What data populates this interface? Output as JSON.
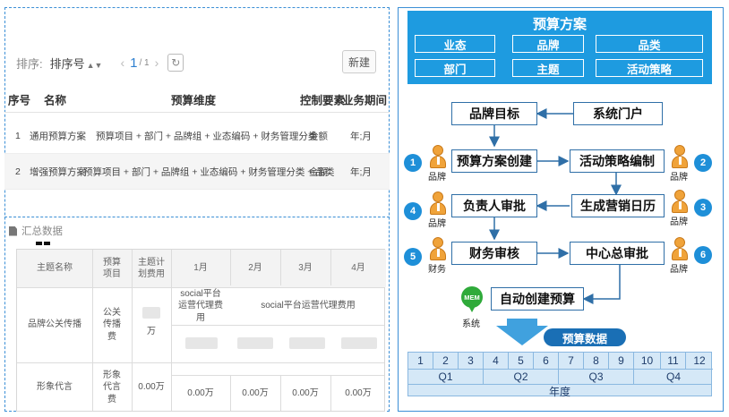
{
  "plan_list": {
    "sort_label": "排序:",
    "sort_value": "排序号",
    "sort_arrows": "▲▼",
    "prev_icon": "‹",
    "next_icon": "›",
    "page_current": "1",
    "page_total": "/ 1",
    "refresh_icon": "↻",
    "new_button": "新建",
    "columns": [
      "序号",
      "名称",
      "预算维度",
      "控制要素",
      "业务期间"
    ],
    "rows": [
      [
        "1",
        "通用预算方案",
        "预算项目 + 部门 + 品牌组 + 业态编码 + 财务管理分类",
        "金额",
        "年;月"
      ],
      [
        "2",
        "增强预算方案",
        "预算项目 + 部门 + 品牌组 + 业态编码 + 财务管理分类 + 品类",
        "金额",
        "年;月"
      ]
    ]
  },
  "summary": {
    "title": "汇总数据",
    "columns": [
      "主题名称",
      "预算项目",
      "主题计划费用",
      "1月",
      "2月",
      "3月",
      "4月"
    ],
    "rows": [
      {
        "name": "品牌公关传播",
        "item": "公关传播费",
        "unit": "万",
        "subheader_1": "social平台运营代理费用",
        "subheader_2": "social平台运营代理费用"
      },
      {
        "name": "形象代言",
        "item": "形象代言费",
        "plan": "0.00万",
        "months": [
          "0.00万",
          "0.00万",
          "0.00万",
          "0.00万"
        ]
      }
    ]
  },
  "flow": {
    "banner_title": "预算方案",
    "dimensions": [
      "业态",
      "品牌",
      "品类",
      "部门",
      "主题",
      "活动策略"
    ],
    "boxes": {
      "brand_target": "品牌目标",
      "system_portal": "系统门户",
      "create_plan": "预算方案创建",
      "strategy": "活动策略编制",
      "owner_approval": "负责人审批",
      "calendar": "生成营销日历",
      "finance_review": "财务审核",
      "center_approval": "中心总审批",
      "auto_budget": "自动创建预算"
    },
    "steps": [
      "1",
      "2",
      "3",
      "4",
      "5",
      "6"
    ],
    "roles": {
      "step1": "品牌",
      "step2": "品牌",
      "step3": "品牌",
      "step4": "品牌",
      "step5": "财务",
      "step6": "品牌",
      "system": "系统"
    },
    "mem_label": "MEM",
    "data_label": "预算数据",
    "months": [
      "1",
      "2",
      "3",
      "4",
      "5",
      "6",
      "7",
      "8",
      "9",
      "10",
      "11",
      "12"
    ],
    "quarters": [
      "Q1",
      "Q2",
      "Q3",
      "Q4"
    ],
    "year_label": "年度"
  },
  "colors": {
    "banner": "#1e9be0",
    "box_border": "#2f6fa7",
    "badge": "#1e8fd8",
    "person": "#f0a33a",
    "mem": "#2faa3a",
    "calendar": "#d5e8f7"
  }
}
